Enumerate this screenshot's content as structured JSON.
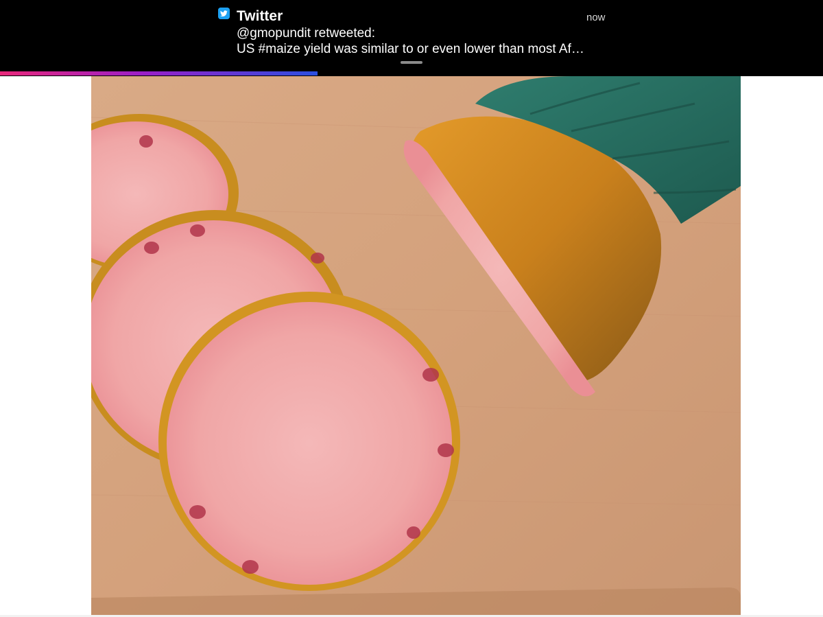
{
  "notification": {
    "app_name": "Twitter",
    "time": "now",
    "title": "@gmopundit retweeted:",
    "body": "US #maize yield was similar to or even lower than most Af…",
    "progress_fraction": 0.386,
    "icon": "twitter-bird-icon"
  },
  "photo": {
    "subject": "pineapple-photo"
  },
  "colors": {
    "banner_bg": "#000000",
    "twitter_blue": "#1da1f2",
    "progress_start": "#e8287a",
    "progress_end": "#2a4fe0"
  }
}
